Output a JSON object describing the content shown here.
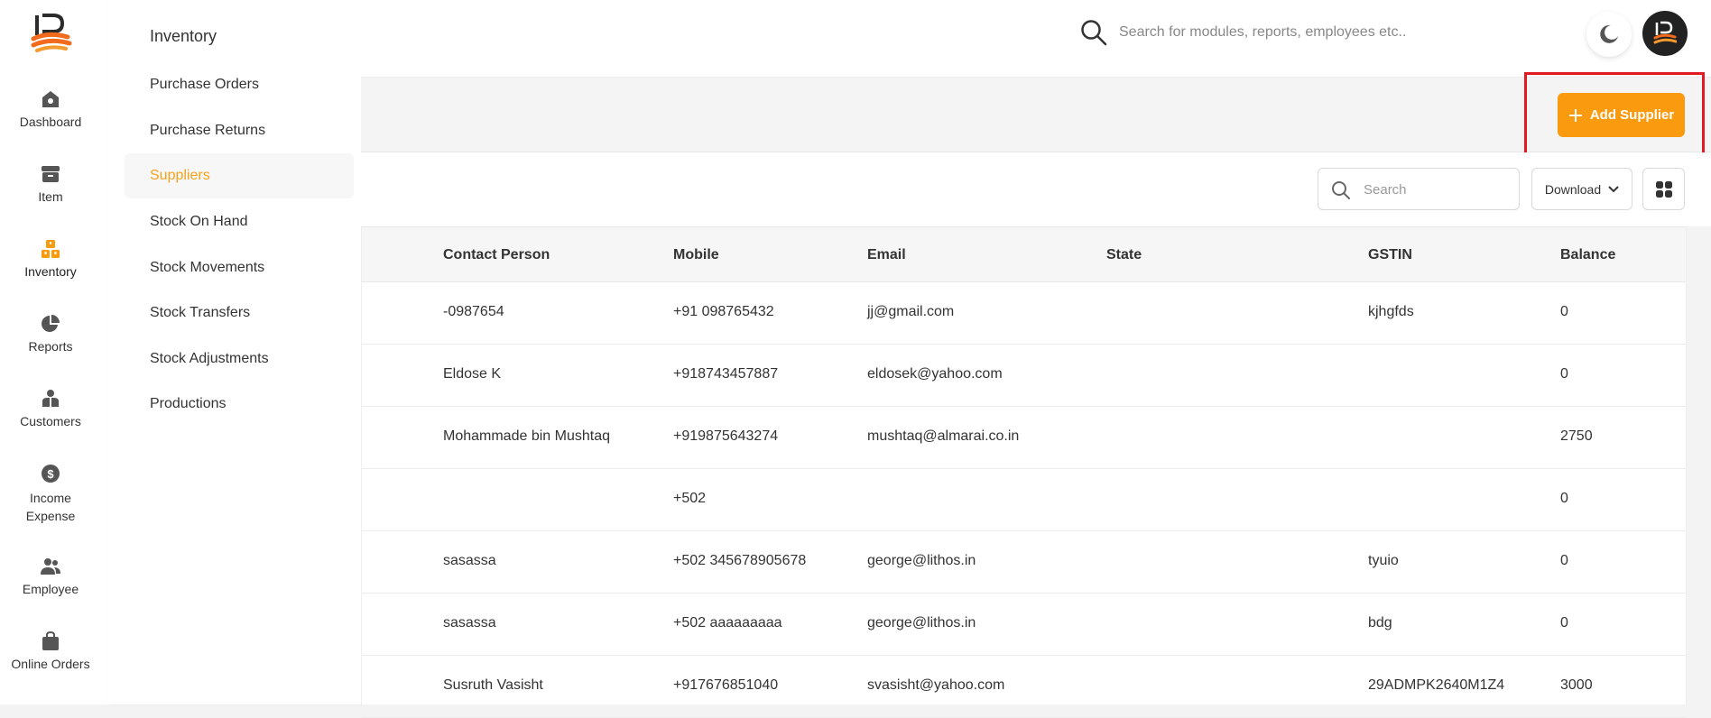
{
  "colors": {
    "accent": "#f99a0f",
    "active_link": "#f6a21a",
    "highlight_border": "#e11b22"
  },
  "rail": {
    "items": [
      {
        "label": "Dashboard",
        "icon": "home-icon"
      },
      {
        "label": "Item",
        "icon": "box-icon"
      },
      {
        "label": "Inventory",
        "icon": "inventory-icon"
      },
      {
        "label": "Reports",
        "icon": "pie-chart-icon"
      },
      {
        "label": "Customers",
        "icon": "customers-icon"
      },
      {
        "label": "Income Expense",
        "icon": "dollar-icon"
      },
      {
        "label": "Employee",
        "icon": "employee-icon"
      },
      {
        "label": "Online Orders",
        "icon": "bag-icon"
      }
    ]
  },
  "submenu": {
    "title": "Inventory",
    "items": [
      {
        "label": "Purchase Orders"
      },
      {
        "label": "Purchase Returns"
      },
      {
        "label": "Suppliers"
      },
      {
        "label": "Stock On Hand"
      },
      {
        "label": "Stock Movements"
      },
      {
        "label": "Stock Transfers"
      },
      {
        "label": "Stock Adjustments"
      },
      {
        "label": "Productions"
      }
    ]
  },
  "header": {
    "search_placeholder": "Search for modules, reports, employees etc.."
  },
  "actions": {
    "add_supplier": "Add Supplier"
  },
  "toolbar": {
    "search_placeholder": "Search",
    "download_label": "Download"
  },
  "table": {
    "columns": [
      "Contact Person",
      "Mobile",
      "Email",
      "State",
      "GSTIN",
      "Balance"
    ],
    "rows": [
      {
        "contact": "-0987654",
        "mobile": "+91 098765432",
        "email": "jj@gmail.com",
        "state": "",
        "gstin": "kjhgfds",
        "balance": "0"
      },
      {
        "contact": "Eldose K",
        "mobile": "+918743457887",
        "email": "eldosek@yahoo.com",
        "state": "",
        "gstin": "",
        "balance": "0"
      },
      {
        "contact": "Mohammade bin Mushtaq",
        "mobile": "+919875643274",
        "email": "mushtaq@almarai.co.in",
        "state": "",
        "gstin": "",
        "balance": "2750"
      },
      {
        "contact": "",
        "mobile": "+502",
        "email": "",
        "state": "",
        "gstin": "",
        "balance": "0"
      },
      {
        "contact": "sasassa",
        "mobile": "+502 345678905678",
        "email": "george@lithos.in",
        "state": "",
        "gstin": "tyuio",
        "balance": "0"
      },
      {
        "contact": "sasassa",
        "mobile": "+502 aaaaaaaaa",
        "email": "george@lithos.in",
        "state": "",
        "gstin": "bdg",
        "balance": "0"
      },
      {
        "contact": "Susruth Vasisht",
        "mobile": "+917676851040",
        "email": "svasisht@yahoo.com",
        "state": "",
        "gstin": "29ADMPK2640M1Z4",
        "balance": "3000"
      }
    ]
  }
}
